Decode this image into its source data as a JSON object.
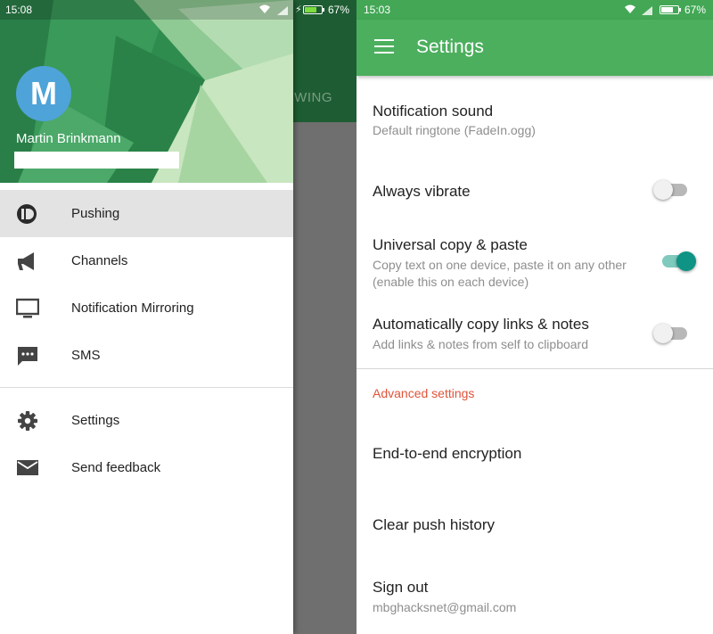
{
  "left_screen": {
    "status_bar": {
      "time": "15:08",
      "battery": "67%"
    },
    "background_tab_text": "OWING",
    "drawer": {
      "avatar_letter": "M",
      "user_name": "Martin Brinkmann",
      "menu": [
        {
          "label": "Pushing",
          "icon": "pushbullet-icon",
          "active": true
        },
        {
          "label": "Channels",
          "icon": "megaphone-icon",
          "active": false
        },
        {
          "label": "Notification Mirroring",
          "icon": "monitor-icon",
          "active": false
        },
        {
          "label": "SMS",
          "icon": "sms-icon",
          "active": false
        }
      ],
      "secondary_menu": [
        {
          "label": "Settings",
          "icon": "gear-icon"
        },
        {
          "label": "Send feedback",
          "icon": "mail-icon"
        }
      ]
    },
    "colors": {
      "appbar_dark": "#1e5d33",
      "active_item": "#e3e3e3",
      "avatar": "#4ea3d9"
    }
  },
  "right_screen": {
    "status_bar": {
      "time": "15:03",
      "battery": "67%"
    },
    "toolbar": {
      "title": "Settings"
    },
    "settings": [
      {
        "title": "Notification sound",
        "subtitle": "Default ringtone (FadeIn.ogg)"
      },
      {
        "title": "Always vibrate",
        "toggle": false
      },
      {
        "title": "Universal copy & paste",
        "subtitle": "Copy text on one device, paste it on any other (enable this on each device)",
        "toggle": true
      },
      {
        "title": "Automatically copy links & notes",
        "subtitle": "Add links & notes from self to clipboard",
        "toggle": false
      }
    ],
    "advanced_header": "Advanced settings",
    "advanced": [
      {
        "title": "End-to-end encryption"
      },
      {
        "title": "Clear push history"
      },
      {
        "title": "Sign out",
        "subtitle": "mbghacksnet@gmail.com"
      }
    ],
    "colors": {
      "toolbar": "#4caf5e",
      "status_bar": "#43a755",
      "accent": "#0e9384",
      "section_header": "#e0533a"
    }
  }
}
